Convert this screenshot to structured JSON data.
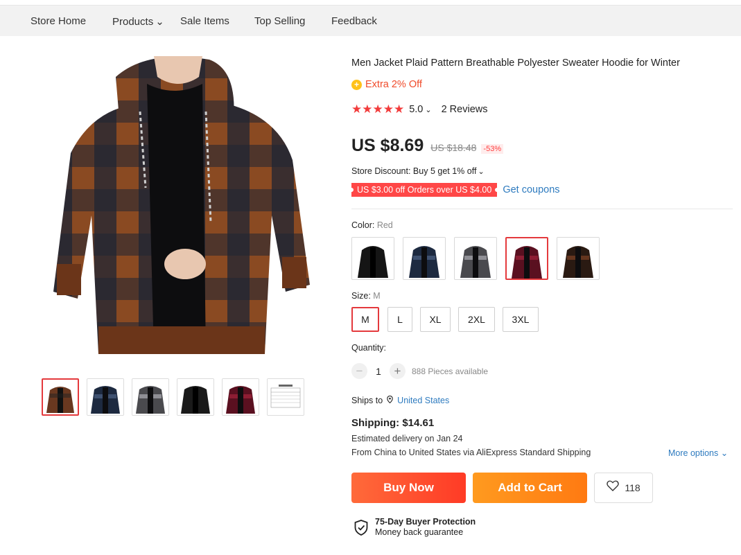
{
  "nav": {
    "items": [
      {
        "label": "Store Home"
      },
      {
        "label": "Products",
        "dropdown": true
      },
      {
        "label": "Sale Items"
      },
      {
        "label": "Top Selling"
      },
      {
        "label": "Feedback"
      }
    ],
    "chevron": "⌄"
  },
  "product": {
    "title": "Men Jacket Plaid Pattern Breathable Polyester Sweater Hoodie for Winter",
    "extra_badge": "Extra 2% Off",
    "stars": "★★★★★",
    "rating": "5.0",
    "reviews": "2 Reviews",
    "price": "US $8.69",
    "old_price": "US $18.48",
    "discount": "-53%",
    "store_discount": "Store Discount: Buy 5 get 1% off",
    "coupon": "US $3.00 off Orders over US $4.00",
    "get_coupons": "Get coupons"
  },
  "color": {
    "label": "Color:",
    "selected": "Red",
    "options": [
      {
        "name": "black-jacket",
        "body": "#151515",
        "plaid": "#2a2a2a"
      },
      {
        "name": "navy-plaid",
        "body": "#1d2a40",
        "plaid": "#3b4d6b"
      },
      {
        "name": "grey-plaid",
        "body": "#4a4a4e",
        "plaid": "#9a9aa0"
      },
      {
        "name": "red-plaid",
        "body": "#5a1020",
        "plaid": "#8a1a30"
      },
      {
        "name": "brown-plaid",
        "body": "#2a1a12",
        "plaid": "#6a3820"
      }
    ]
  },
  "size": {
    "label": "Size:",
    "selected": "M",
    "options": [
      "M",
      "L",
      "XL",
      "2XL",
      "3XL"
    ]
  },
  "quantity": {
    "label": "Quantity:",
    "minus": "−",
    "value": "1",
    "plus": "+",
    "available": "888 Pieces available"
  },
  "shipping": {
    "ships_to_label": "Ships to",
    "destination": "United States",
    "cost": "Shipping: $14.61",
    "estimated": "Estimated delivery on Jan 24",
    "from_line": "From China to United States via AliExpress Standard Shipping",
    "more_options": "More options ⌄"
  },
  "actions": {
    "buy_now": "Buy Now",
    "add_to_cart": "Add to Cart",
    "wish_count": "118"
  },
  "protection": {
    "title": "75-Day Buyer Protection",
    "subtitle": "Money back guarantee"
  },
  "colors": {
    "accent": "#e4393c",
    "link": "#2e7bbf",
    "buy": "#ff3b26",
    "cart": "#ff7a12"
  }
}
